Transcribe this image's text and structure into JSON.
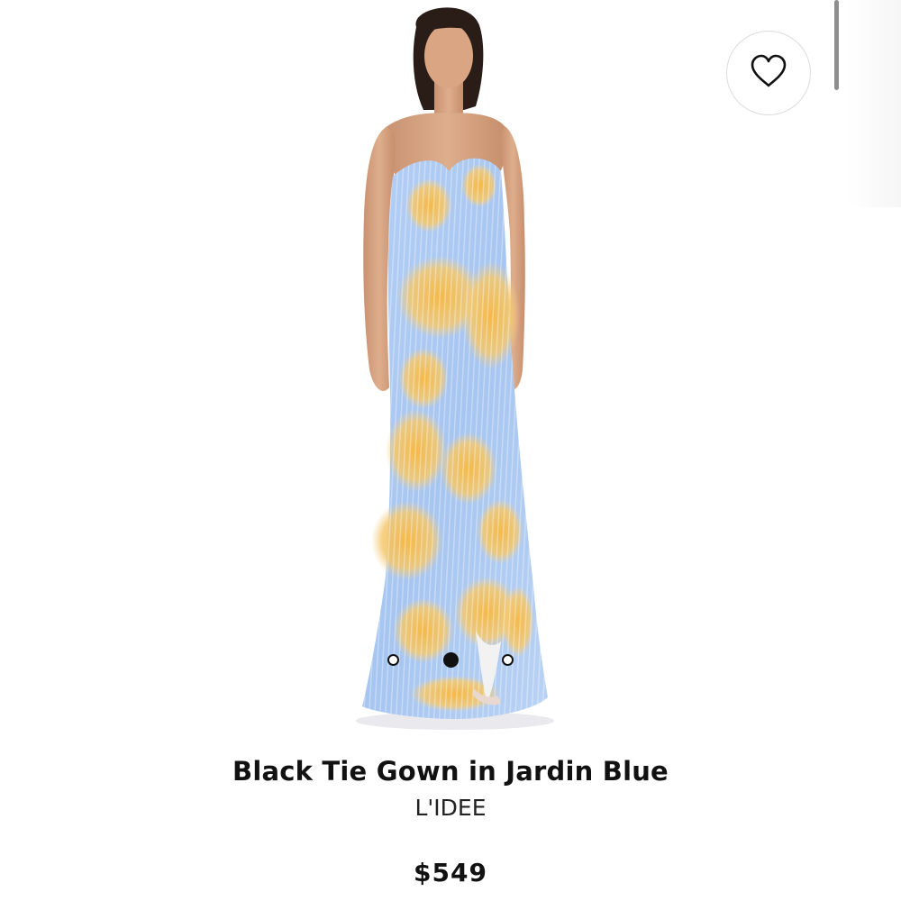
{
  "product": {
    "title": "Black Tie Gown in Jardin Blue",
    "brand": "L'IDEE",
    "price": "$549",
    "image_alt": "Model wearing a strapless pleated gown with blue and yellow floral print"
  },
  "gallery": {
    "dots": [
      "image-1",
      "image-2",
      "image-3"
    ],
    "active_index": 1
  },
  "icons": {
    "wishlist": "heart-outline-icon"
  },
  "colors": {
    "dress_blue": "#a9c8f2",
    "dress_yellow": "#f2c35a",
    "text": "#111111",
    "button_border": "#dcdcdc"
  }
}
